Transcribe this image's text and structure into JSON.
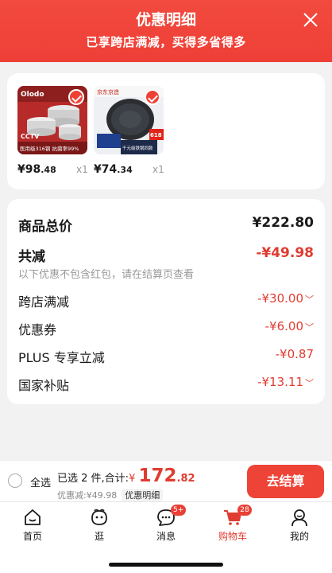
{
  "header": {
    "title": "优惠明细",
    "subtitle": "已享跨店满减，买得多省得多"
  },
  "items": [
    {
      "price_int": "¥98",
      "price_dec": ".48",
      "qty": "x1",
      "thumb_brand": "Olodo",
      "thumb_caption": "医用级316钢 抗菌率99%",
      "thumb_logo": "CCTV"
    },
    {
      "price_int": "¥74",
      "price_dec": ".34",
      "qty": "x1",
      "thumb_brand": "京东京造",
      "thumb_caption": "千元级铁锅同款",
      "thumb_badge": "618"
    }
  ],
  "summary": {
    "total_label": "商品总价",
    "total_value": "¥222.80",
    "reduce_label": "共减",
    "reduce_value": "-¥49.98",
    "note": "以下优惠不包含红包，请在结算页查看",
    "lines": [
      {
        "label": "跨店满减",
        "value": "-¥30.00"
      },
      {
        "label": "优惠券",
        "value": "-¥6.00"
      },
      {
        "label": "PLUS 专享立减",
        "value": "-¥0.87"
      },
      {
        "label": "国家补贴",
        "value": "-¥13.11"
      }
    ]
  },
  "bottom": {
    "select_all": "全选",
    "selected_text": "已选 2 件,合计:",
    "currency": "¥",
    "amount_int": "172",
    "amount_dec": ".82",
    "discount_text": "优惠减:¥49.98",
    "detail_tag": "优惠明细",
    "checkout": "去结算"
  },
  "tabs": [
    {
      "label": "首页",
      "icon": "home-icon"
    },
    {
      "label": "逛",
      "icon": "stroll-face-icon"
    },
    {
      "label": "消息",
      "icon": "message-icon",
      "badge": "5+"
    },
    {
      "label": "购物车",
      "icon": "cart-icon",
      "badge": "28",
      "active": true
    },
    {
      "label": "我的",
      "icon": "profile-icon"
    }
  ],
  "colors": {
    "accent": "#ee4337",
    "price_red": "#e03c31"
  }
}
